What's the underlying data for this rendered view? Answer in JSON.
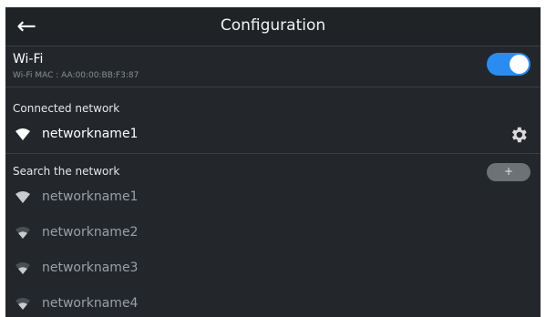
{
  "header": {
    "title": "Configuration",
    "back_icon": "arrow-left-icon"
  },
  "wifi": {
    "label": "Wi-Fi",
    "mac": "Wi-Fi MAC : AA:00:00:BB:F3:87",
    "enabled": true,
    "toggle_color": "#2a8cf0"
  },
  "connected": {
    "label": "Connected network",
    "network": {
      "name": "networkname1",
      "signal_icon": "wifi-signal-icon"
    },
    "settings_icon": "gear-icon"
  },
  "search": {
    "label": "Search the network",
    "add_label": "+",
    "networks": [
      {
        "name": "networkname1",
        "signal": "full"
      },
      {
        "name": "networkname2",
        "signal": "medium"
      },
      {
        "name": "networkname3",
        "signal": "medium"
      },
      {
        "name": "networkname4",
        "signal": "medium"
      }
    ]
  }
}
